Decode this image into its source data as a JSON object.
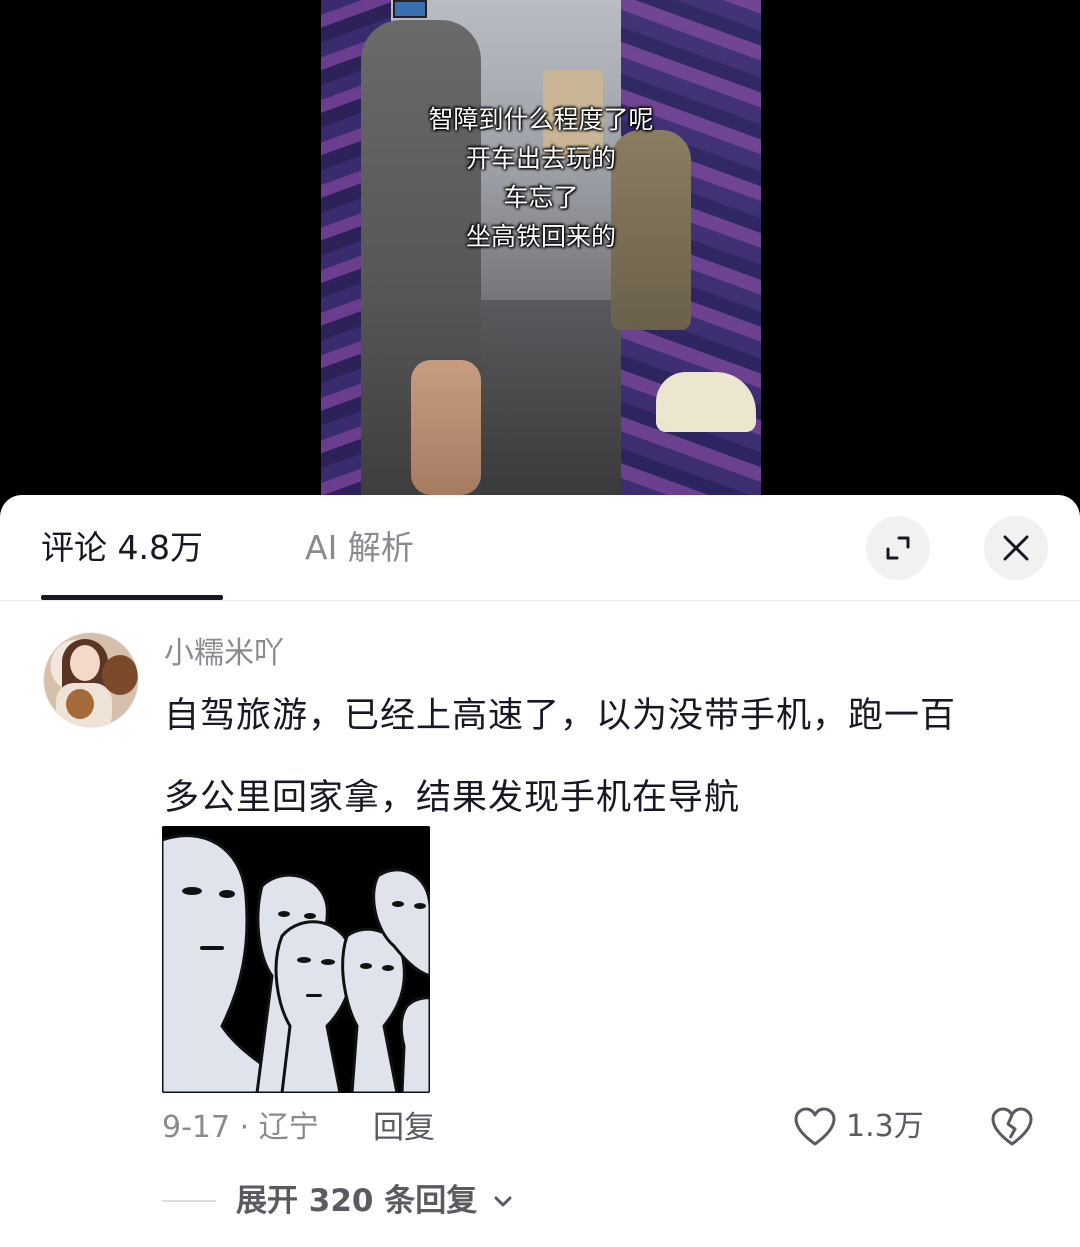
{
  "video": {
    "caption_lines": [
      "智障到什么程度了呢",
      "开车出去玩的",
      "车忘了",
      "坐高铁回来的"
    ]
  },
  "tabs": {
    "comments_label": "评论 4.8万",
    "ai_label": "AI 解析",
    "expand_icon": "expand-icon",
    "close_icon": "close-icon"
  },
  "comment": {
    "username": "小糯米吖",
    "text_lines": [
      "自驾旅游，已经上高速了，以为没带手机，跑一百",
      "多公里回家拿，结果发现手机在导航"
    ],
    "meta": "9-17 · 辽宁",
    "reply_label": "回复",
    "like_count": "1.3万",
    "expand_replies": "展开 320 条回复"
  },
  "colors": {
    "primary_text": "#161823",
    "secondary_text": "#8a8b91",
    "button_bg": "#f1f1f2"
  }
}
